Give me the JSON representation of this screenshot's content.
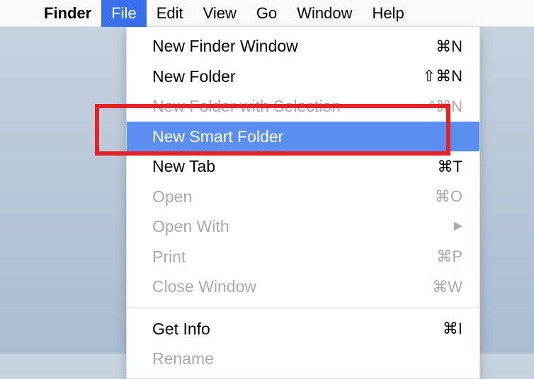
{
  "menubar": {
    "app_name": "Finder",
    "items": [
      {
        "label": "File",
        "active": true
      },
      {
        "label": "Edit",
        "active": false
      },
      {
        "label": "View",
        "active": false
      },
      {
        "label": "Go",
        "active": false
      },
      {
        "label": "Window",
        "active": false
      },
      {
        "label": "Help",
        "active": false
      }
    ]
  },
  "dropdown": {
    "items": [
      {
        "label": "New Finder Window",
        "shortcut": "⌘N",
        "disabled": false,
        "highlighted": false
      },
      {
        "label": "New Folder",
        "shortcut": "⇧⌘N",
        "disabled": false,
        "highlighted": false
      },
      {
        "label": "New Folder with Selection",
        "shortcut": "^⌘N",
        "disabled": true,
        "highlighted": false
      },
      {
        "label": "New Smart Folder",
        "shortcut": "",
        "disabled": false,
        "highlighted": true
      },
      {
        "label": "New Tab",
        "shortcut": "⌘T",
        "disabled": false,
        "highlighted": false
      },
      {
        "label": "Open",
        "shortcut": "⌘O",
        "disabled": true,
        "highlighted": false
      },
      {
        "label": "Open With",
        "shortcut": "",
        "disabled": true,
        "highlighted": false,
        "submenu": true
      },
      {
        "label": "Print",
        "shortcut": "⌘P",
        "disabled": true,
        "highlighted": false
      },
      {
        "label": "Close Window",
        "shortcut": "⌘W",
        "disabled": true,
        "highlighted": false
      },
      {
        "separator": true
      },
      {
        "label": "Get Info",
        "shortcut": "⌘I",
        "disabled": false,
        "highlighted": false
      },
      {
        "label": "Rename",
        "shortcut": "",
        "disabled": true,
        "highlighted": false
      }
    ]
  }
}
